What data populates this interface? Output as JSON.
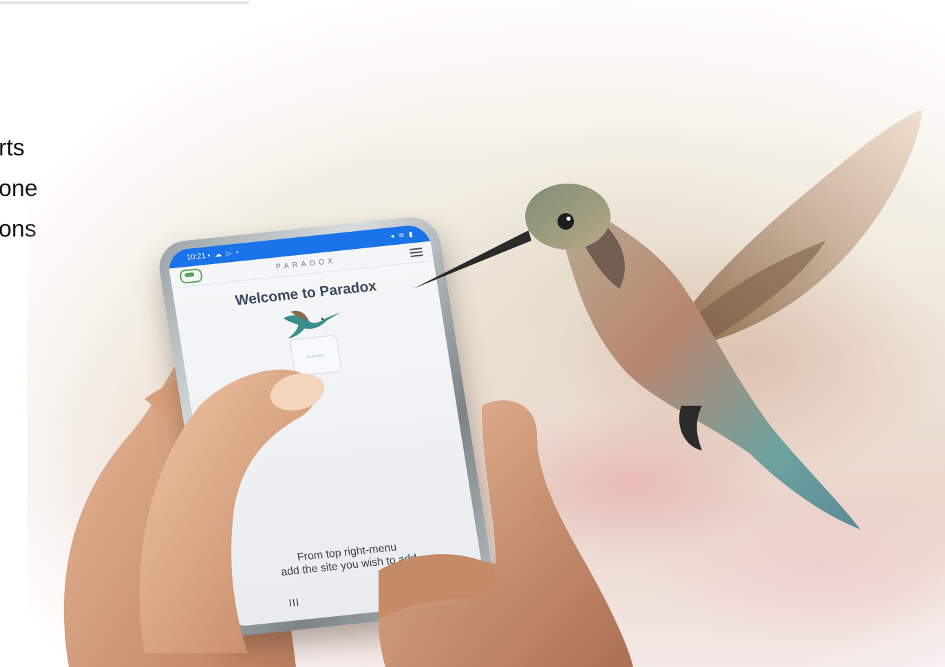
{
  "left_text": {
    "line1": "rts",
    "line2": "one",
    "line3": "ons"
  },
  "phone": {
    "status_time": "10:21",
    "status_left_icons": "▪ ☁ ▷ •",
    "status_right_icons": "◂ ≋ ▮",
    "brand": "PARADOX",
    "welcome_title": "Welcome to Paradox",
    "device_label": "PARADOX",
    "instruction_line1": "From top right-menu",
    "instruction_line2": "add the site you wish to add",
    "nav_recents": "III"
  },
  "colors": {
    "status_bar": "#1a73e8",
    "accent_green": "#57a55a",
    "title_text": "#3d4a5c"
  }
}
